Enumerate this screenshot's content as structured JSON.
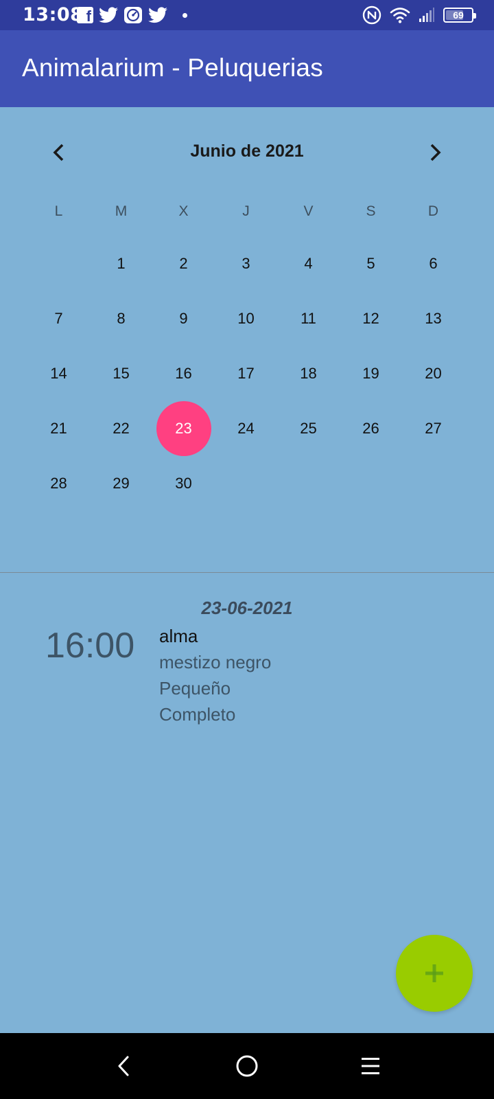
{
  "status_bar": {
    "time": "13:08",
    "battery": "69",
    "battery_level": 0.69,
    "icons_left": [
      "facebook-icon",
      "twitter-icon",
      "speedometer-icon",
      "twitter-icon",
      "dot-icon"
    ],
    "icons_right": [
      "nfc-icon",
      "wifi-icon",
      "signal-icon",
      "battery-icon"
    ]
  },
  "app_bar": {
    "title": "Animalarium - Peluquerias",
    "color": "#3f51b5"
  },
  "calendar": {
    "month_label": "Junio de 2021",
    "weekdays": [
      "L",
      "M",
      "X",
      "J",
      "V",
      "S",
      "D"
    ],
    "weeks": [
      [
        "",
        "1",
        "2",
        "3",
        "4",
        "5",
        "6"
      ],
      [
        "7",
        "8",
        "9",
        "10",
        "11",
        "12",
        "13"
      ],
      [
        "14",
        "15",
        "16",
        "17",
        "18",
        "19",
        "20"
      ],
      [
        "21",
        "22",
        "23",
        "24",
        "25",
        "26",
        "27"
      ],
      [
        "28",
        "29",
        "30",
        "",
        "",
        "",
        ""
      ]
    ],
    "selected_day": "23",
    "selected_color": "#ff4081"
  },
  "appointment": {
    "date": "23-06-2021",
    "time": "16:00",
    "name": "alma",
    "details": [
      "mestizo negro",
      "Pequeño",
      "Completo"
    ]
  },
  "fab": {
    "icon": "plus-icon",
    "color": "#99cc00"
  },
  "nav_bar": {
    "icons": [
      "back-icon",
      "home-icon",
      "menu-icon"
    ]
  }
}
